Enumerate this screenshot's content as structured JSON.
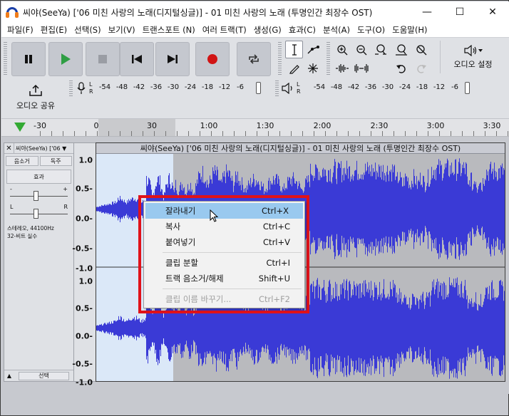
{
  "window": {
    "title": "씨야(SeeYa) ['06 미친 사랑의 노래(디지털싱글)] - 01 미친 사랑의 노래 (투명인간 최장수 OST)",
    "minimize_glyph": "—",
    "maximize_glyph": "☐",
    "close_glyph": "✕"
  },
  "menu": [
    "파일(F)",
    "편집(E)",
    "선택(S)",
    "보기(V)",
    "트랜스포트 (N)",
    "여러 트랙(T)",
    "생성(G)",
    "효과(C)",
    "분석(A)",
    "도구(O)",
    "도움말(H)"
  ],
  "toolbar": {
    "transport_icons": [
      "pause-icon",
      "play-icon",
      "stop-icon",
      "skip-start-icon",
      "skip-end-icon",
      "record-icon",
      "loop-icon"
    ],
    "tool_icons": [
      "select-tool-icon",
      "envelope-tool-icon",
      "draw-tool-icon",
      "multi-tool-icon"
    ],
    "edit_icons": [
      "zoom-in-icon",
      "zoom-out-icon",
      "fit-selection-icon",
      "fit-project-icon",
      "zoom-toggle-icon",
      "trim-icon",
      "silence-icon",
      "undo-icon",
      "redo-icon"
    ],
    "audio_setup_label": "오디오 설정",
    "share_label": "오디오 공유",
    "record_meter_ticks": [
      "-54",
      "-48",
      "-42",
      "-36",
      "-30",
      "-24",
      "-18",
      "-12",
      "-6"
    ],
    "play_meter_ticks": [
      "-54",
      "-48",
      "-42",
      "-36",
      "-30",
      "-24",
      "-18",
      "-12",
      "-6"
    ],
    "meter_channels": [
      "L",
      "R"
    ]
  },
  "timeline": {
    "labels": [
      "-30",
      "0",
      "30",
      "1:00",
      "1:30",
      "2:00",
      "2:30",
      "3:00",
      "3:30"
    ]
  },
  "track": {
    "name": "씨야(SeeYa) ['06 ▼",
    "mute": "음소거",
    "solo": "독주",
    "effects": "효과",
    "gain_minus": "-",
    "gain_plus": "+",
    "pan_left": "L",
    "pan_right": "R",
    "info_line1": "스테레오, 44100Hz",
    "info_line2": "32-비트 실수",
    "select": "선택",
    "clip_title": "씨야(SeeYa) ['06 미친 사랑의 노래(디지털싱글)] - 01 미친 사랑의 노래 (투명인간 최장수 OST)",
    "ruler_labels": [
      "1.0",
      "0.5-",
      "0.0-",
      "-0.5-",
      "-1.0",
      "1.0",
      "0.5-",
      "0.0-",
      "-0.5-",
      "-1.0"
    ]
  },
  "context_menu": {
    "items": [
      {
        "label": "잘라내기",
        "shortcut": "Ctrl+X",
        "state": "hover"
      },
      {
        "label": "복사",
        "shortcut": "Ctrl+C",
        "state": "normal"
      },
      {
        "label": "붙여넣기",
        "shortcut": "Ctrl+V",
        "state": "normal"
      },
      {
        "label": "클립 분할",
        "shortcut": "Ctrl+I",
        "state": "normal"
      },
      {
        "label": "트랙 음소거/해제",
        "shortcut": "Shift+U",
        "state": "normal"
      },
      {
        "label": "클립 이름 바꾸기...",
        "shortcut": "Ctrl+F2",
        "state": "disabled"
      }
    ]
  },
  "colors": {
    "waveform": "#3a3ad6",
    "waveform_selected": "#4848e4",
    "highlight_box": "#e0121a",
    "menu_hover": "#99c9ef",
    "play_green": "#33aa33",
    "record_red": "#d11414"
  }
}
